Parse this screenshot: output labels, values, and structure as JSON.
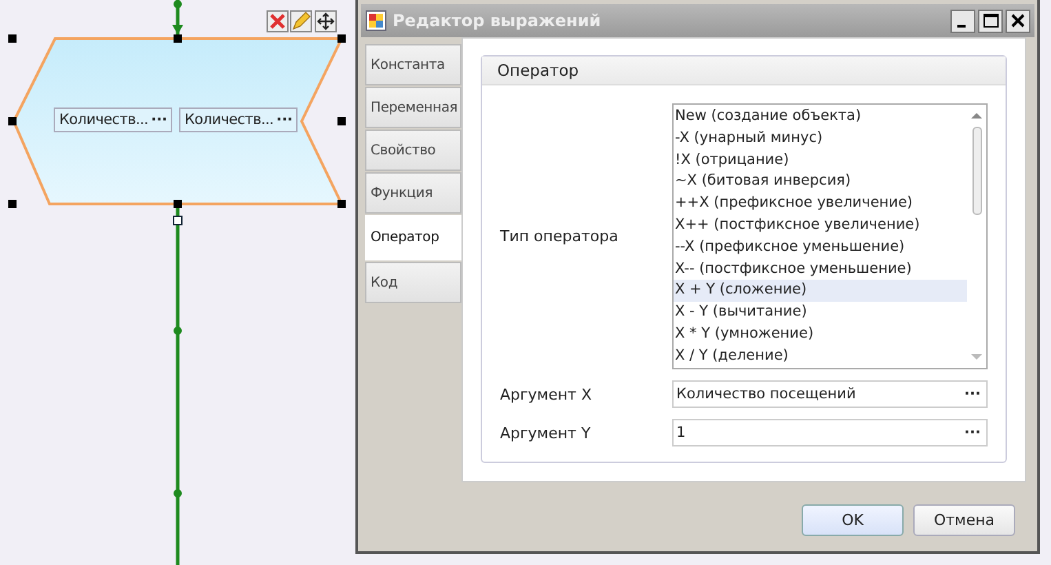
{
  "diagram": {
    "block": {
      "fields": [
        {
          "text": "Количеств...",
          "button": "···"
        },
        {
          "text": "Количеств...",
          "button": "···"
        }
      ]
    }
  },
  "dialog": {
    "title": "Редактор выражений",
    "tabs": [
      {
        "label": "Константа",
        "selected": false
      },
      {
        "label": "Переменная",
        "selected": false
      },
      {
        "label": "Свойство",
        "selected": false
      },
      {
        "label": "Функция",
        "selected": false
      },
      {
        "label": "Оператор",
        "selected": true
      },
      {
        "label": "Код",
        "selected": false
      }
    ],
    "group": {
      "title": "Оператор",
      "operator_label": "Тип оператора",
      "operators": [
        {
          "label": "New (создание объекта)",
          "selected": false
        },
        {
          "label": "-X (унарный минус)",
          "selected": false
        },
        {
          "label": "!X (отрицание)",
          "selected": false
        },
        {
          "label": "~X (битовая инверсия)",
          "selected": false
        },
        {
          "label": "++X (префиксное увеличение)",
          "selected": false
        },
        {
          "label": "X++ (постфиксное увеличение)",
          "selected": false
        },
        {
          "label": "--X (префиксное уменьшение)",
          "selected": false
        },
        {
          "label": "X-- (постфиксное уменьшение)",
          "selected": false
        },
        {
          "label": "X + Y (сложение)",
          "selected": true
        },
        {
          "label": "X - Y (вычитание)",
          "selected": false
        },
        {
          "label": "X * Y (умножение)",
          "selected": false
        },
        {
          "label": "X / Y (деление)",
          "selected": false
        }
      ],
      "arguments": [
        {
          "label": "Аргумент X",
          "value": "Количество посещений",
          "button": "···"
        },
        {
          "label": "Аргумент Y",
          "value": "1",
          "button": "···"
        }
      ]
    },
    "buttons": [
      "OK",
      "Отмена"
    ]
  }
}
